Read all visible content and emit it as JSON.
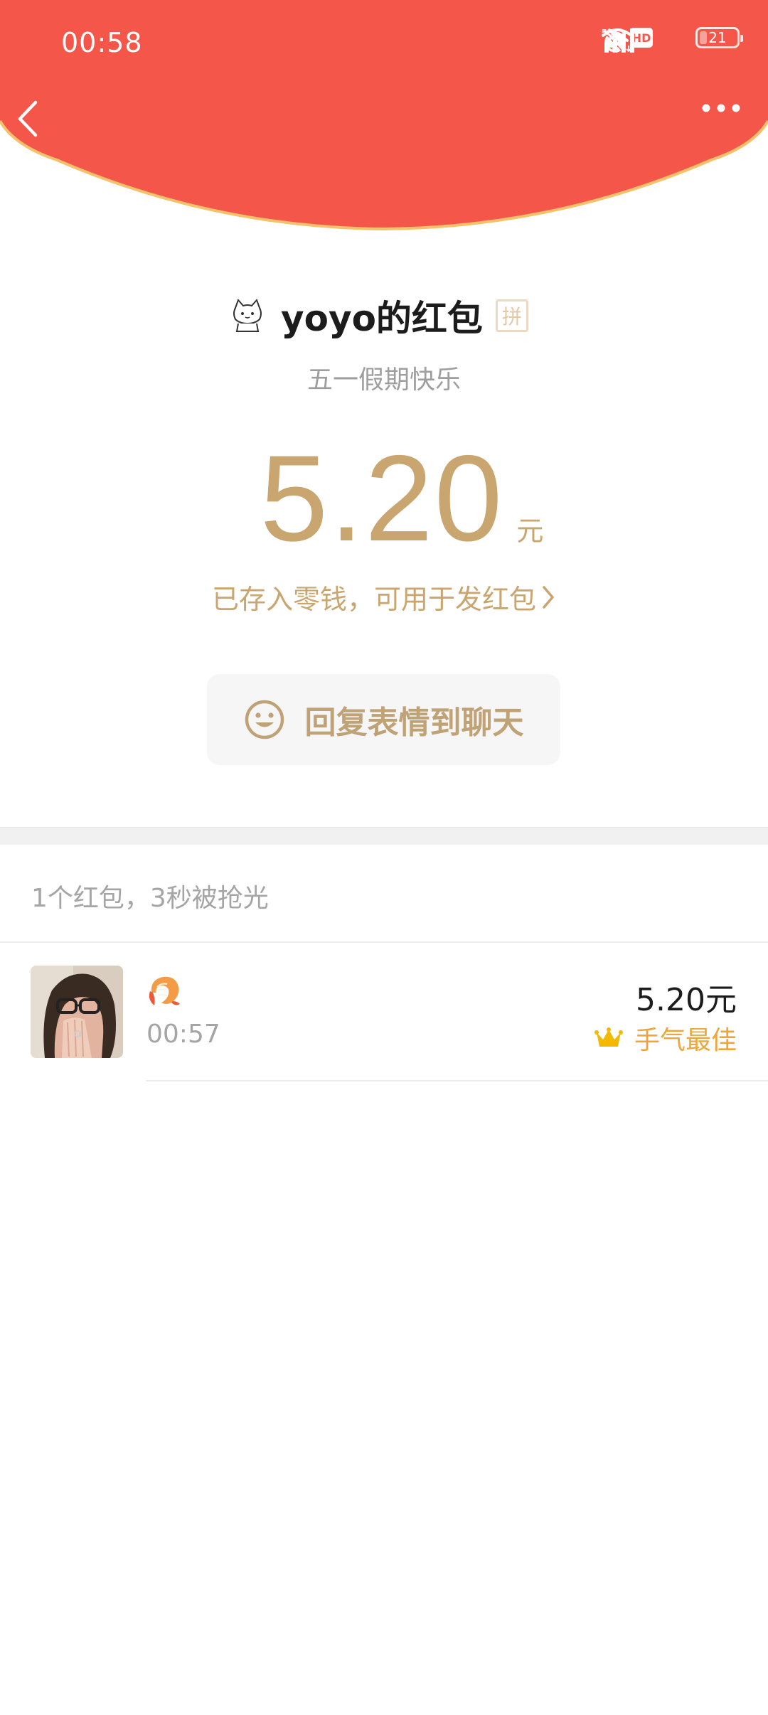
{
  "status_bar": {
    "time": "00:58",
    "hd_label": "HD",
    "network_label": "5G",
    "battery_level": "21"
  },
  "colors": {
    "header_red": "#f4574a",
    "header_rim": "#f5c26b",
    "gold": "#c9a56f",
    "best_luck": "#efa53a"
  },
  "icons": {
    "back": "chevron-left-icon",
    "more": "more-dots-icon",
    "alarm": "alarm-icon",
    "mute": "bell-off-icon",
    "wifi": "wifi-icon",
    "signal": "signal-icon",
    "reply": "smiley-icon",
    "crown": "crown-icon"
  },
  "envelope": {
    "sender_name": "yoyo的红包",
    "pin_badge": "拼",
    "greeting": "五一假期快乐",
    "amount": "5.20",
    "unit": "元",
    "wallet_link": "已存入零钱，可用于发红包"
  },
  "reply_button": {
    "label": "回复表情到聊天"
  },
  "summary": "1个红包，3秒被抢光",
  "recipients": [
    {
      "time": "00:57",
      "amount": "5.20元",
      "badge": "手气最佳"
    }
  ]
}
